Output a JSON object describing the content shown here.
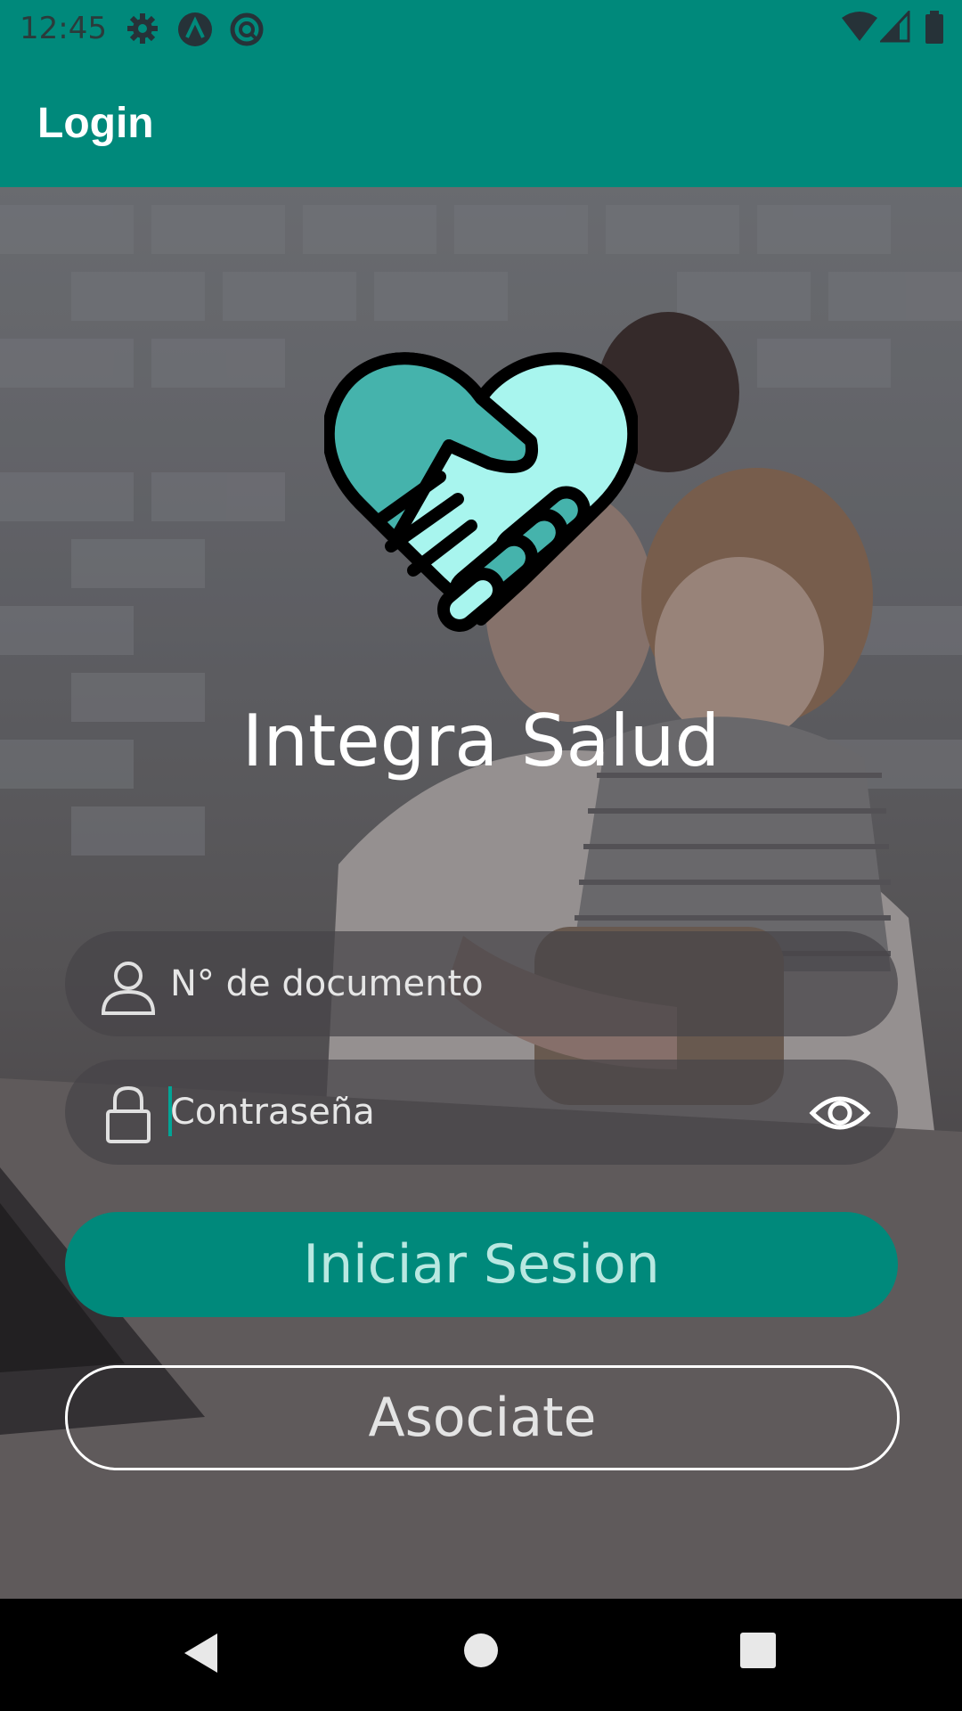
{
  "status_bar": {
    "time": "12:45",
    "left_icons": [
      "settings-icon",
      "app-a-icon",
      "sync-icon"
    ],
    "right_icons": [
      "wifi-icon",
      "signal-icon",
      "battery-icon"
    ]
  },
  "app_bar": {
    "title": "Login"
  },
  "brand": {
    "name": "Integra Salud",
    "logo": "handshake-heart-logo"
  },
  "form": {
    "document_field": {
      "placeholder": "N° de documento",
      "icon": "person-icon"
    },
    "password_field": {
      "placeholder": "Contraseña",
      "icon": "lock-icon",
      "toggle_icon": "eye-icon"
    }
  },
  "buttons": {
    "login_label": "Iniciar Sesion",
    "register_label": "Asociate"
  },
  "nav": [
    "back-icon",
    "home-icon",
    "recents-icon"
  ],
  "colors": {
    "primary": "#00897B",
    "on_primary_text": "#B9E8E1",
    "logo_light": "#A8F5EE",
    "logo_dark": "#45B3AC"
  }
}
